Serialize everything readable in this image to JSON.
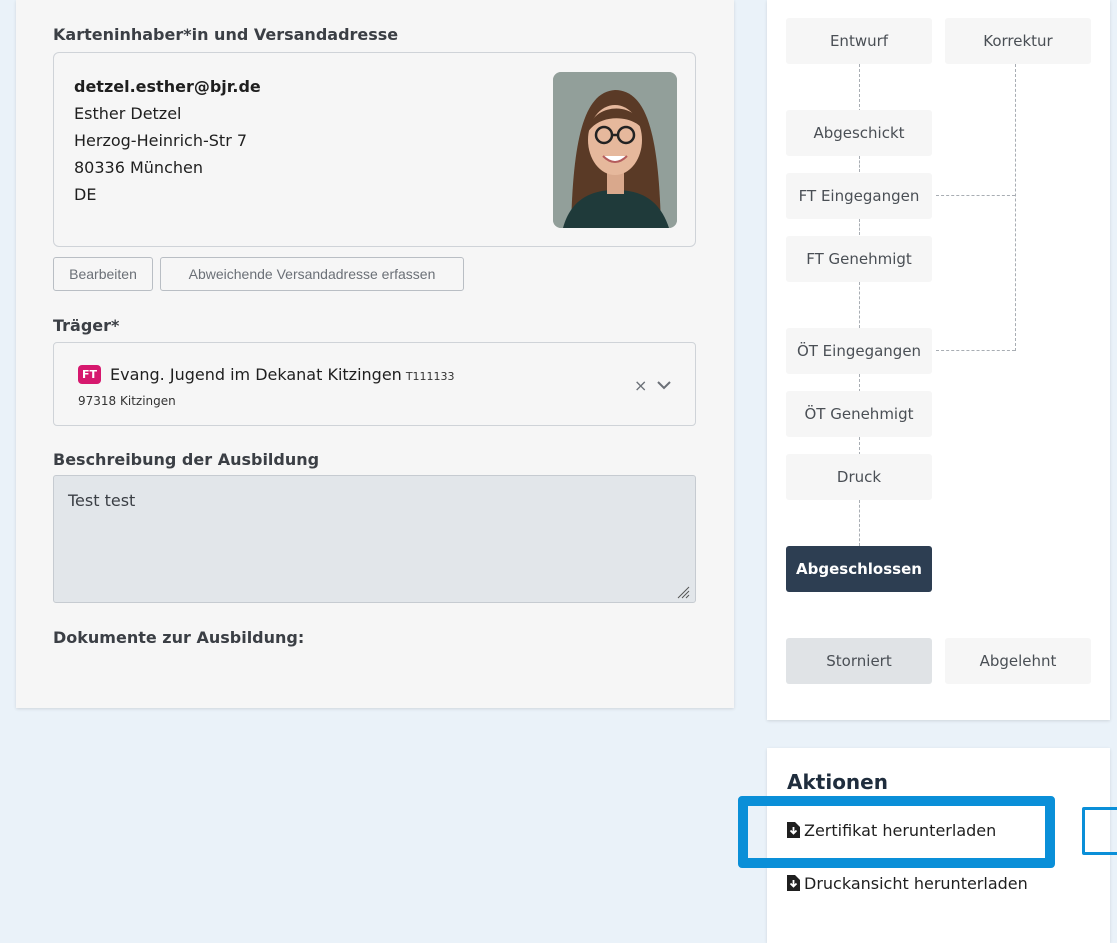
{
  "owner_section": {
    "label": "Karteninhaber*in und Versandadresse",
    "email": "detzel.esther@bjr.de",
    "name": "Esther Detzel",
    "street": "Herzog-Heinrich-Str 7",
    "city": "80336 München",
    "country": "DE",
    "edit_label": "Bearbeiten",
    "alt_address_label": "Abweichende Versandadresse erfassen"
  },
  "traeger": {
    "label": "Träger*",
    "badge": "FT",
    "name": "Evang. Jugend im Dekanat Kitzingen",
    "code": "T111133",
    "city": "97318 Kitzingen",
    "clear_icon": "×"
  },
  "beschreibung": {
    "label": "Beschreibung der Ausbildung",
    "value": "Test test"
  },
  "dokumente": {
    "label": "Dokumente zur Ausbildung:"
  },
  "workflow": {
    "entwurf": "Entwurf",
    "korrektur": "Korrektur",
    "abgeschickt": "Abgeschickt",
    "ft_eingegangen": "FT Eingegangen",
    "ft_genehmigt": "FT Genehmigt",
    "oet_eingegangen": "ÖT Eingegangen",
    "oet_genehmigt": "ÖT Genehmigt",
    "druck": "Druck",
    "abgeschlossen": "Abgeschlossen",
    "storniert": "Storniert",
    "abgelehnt": "Abgelehnt",
    "active_color": "#2d3e52"
  },
  "actions": {
    "title": "Aktionen",
    "download_certificate": "Zertifikat herunterladen",
    "download_print": "Druckansicht herunterladen",
    "highlight_color": "#0a8fd8"
  }
}
